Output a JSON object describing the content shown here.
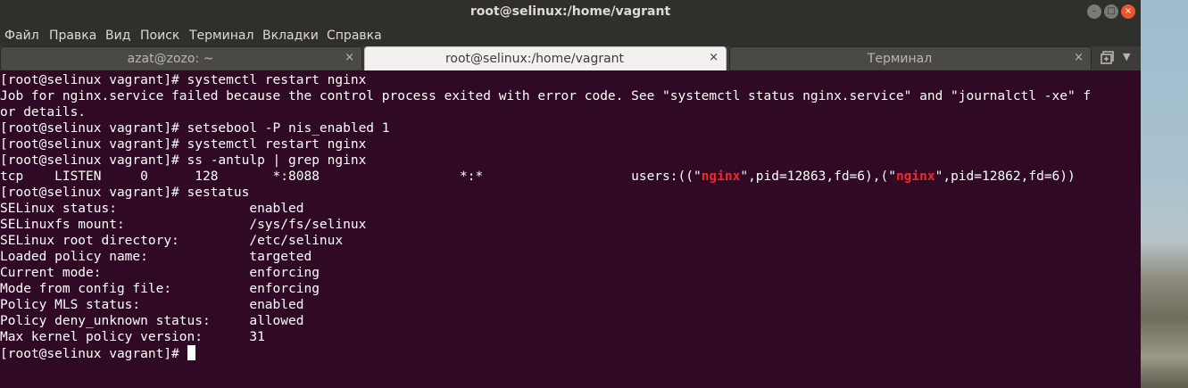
{
  "window": {
    "title": "root@selinux:/home/vagrant",
    "min_icon": "minimize-icon",
    "max_icon": "maximize-icon",
    "close_icon": "close-icon"
  },
  "menubar": [
    "Файл",
    "Правка",
    "Вид",
    "Поиск",
    "Терминал",
    "Вкладки",
    "Справка"
  ],
  "tabs": [
    {
      "label": "azat@zozo: ~",
      "close": "×",
      "active": false
    },
    {
      "label": "root@selinux:/home/vagrant",
      "close": "×",
      "active": true
    },
    {
      "label": "Терминал",
      "close": "×",
      "active": false
    }
  ],
  "tabbar_icons": {
    "new_tab": "new-tab-icon",
    "tab_menu": "▼"
  },
  "terminal": {
    "lines": [
      "[root@selinux vagrant]# systemctl restart nginx",
      "Job for nginx.service failed because the control process exited with error code. See \"systemctl status nginx.service\" and \"journalctl -xe\" f",
      "or details.",
      "[root@selinux vagrant]# setsebool -P nis_enabled 1",
      "[root@selinux vagrant]# systemctl restart nginx",
      "[root@selinux vagrant]# ss -antulp | grep nginx",
      "",
      "[root@selinux vagrant]# sestatus",
      "SELinux status:                 enabled",
      "SELinuxfs mount:                /sys/fs/selinux",
      "SELinux root directory:         /etc/selinux",
      "Loaded policy name:             targeted",
      "Current mode:                   enforcing",
      "Mode from config file:          enforcing",
      "Policy MLS status:              enabled",
      "Policy deny_unknown status:     allowed",
      "Max kernel policy version:      31",
      "[root@selinux vagrant]# "
    ],
    "ss_line": {
      "prefix": "tcp    LISTEN     0      128       *:8088                  *:*                   users:((\"",
      "proc1": "nginx",
      "mid": "\",pid=12863,fd=6),(\"",
      "proc2": "nginx",
      "suffix": "\",pid=12862,fd=6))"
    }
  },
  "colors": {
    "terminal_bg": "#300a24",
    "text": "#ffffff",
    "highlight": "#ef2929",
    "titlebar": "#2f2f2b"
  }
}
